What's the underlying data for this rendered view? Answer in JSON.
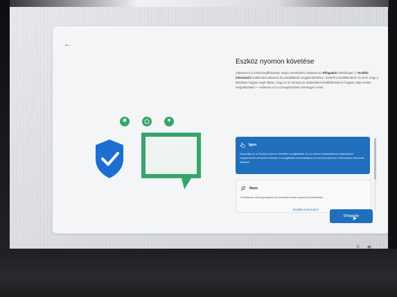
{
  "header": {
    "title": "Eszköz nyomon követése"
  },
  "main": {
    "intro_1": "Válassza ki a kívánt beállításokat, majd a mentéshez válassza az",
    "intro_accept_word": "Elfogadás",
    "intro_2": "lehetőséget. A",
    "intro_more_word": "További információ",
    "intro_3": "hivatkozást válassza ki a beállítások megjelenítéséhez. Ezekről a beállításokról, és arról, hogy a Windows hogyan segít abban, hogy az ön ismerje az adatvédelmi beállításokat és hogyan tudja ezeket megváltoztatni — érdemes ezt a szövegrészletet szemügyre venni."
  },
  "options": {
    "yes_label": "Igen",
    "yes_desc": "Kapcsolja be az Eszköz nyomon követése szolgáltatást, és az eszköz helyadatainak segítségével megkeresheti elveszett eszközét. A szolgáltatás használatához be kell jelentkeznie a Windowsba Microsoft-fiókjával.",
    "no_label": "Nem",
    "no_desc": "A Windows nem fog segíteni az elveszett eszköz nyomon követésében."
  },
  "footer": {
    "more_info": "További információ",
    "accept": "Elfogadás"
  },
  "colors": {
    "accent": "#1f6fbd",
    "shield": "#1c6fd1",
    "green": "#36a56a"
  },
  "icons": [
    "back-arrow-icon",
    "shield-check-icon",
    "location-pin-icon",
    "fingerprint-icon",
    "person-icon",
    "hand-pointer-icon",
    "network-icon",
    "volume-icon"
  ]
}
